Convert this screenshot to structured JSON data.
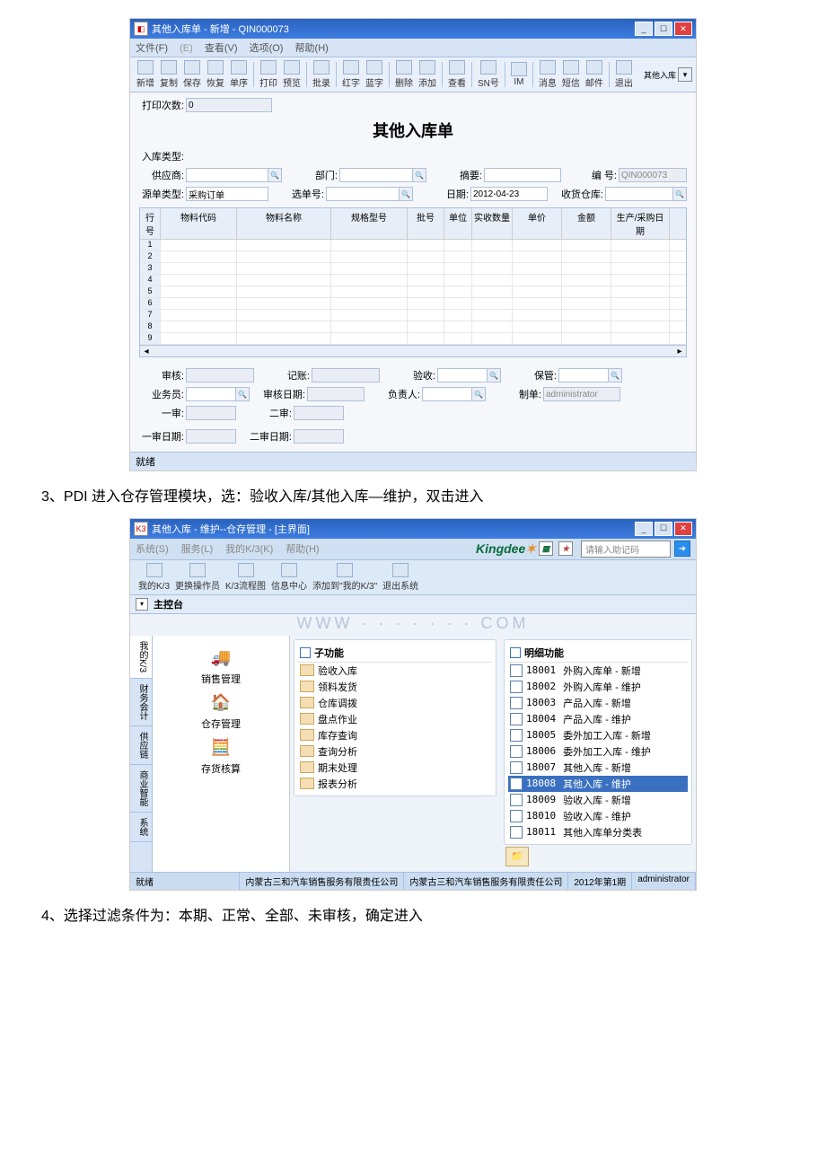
{
  "win1": {
    "title": "其他入库单 - 新增 - QIN000073",
    "menus": {
      "file": "文件(F)",
      "view": "查看(V)",
      "option": "选项(O)",
      "help": "帮助(H)"
    },
    "toolbar": [
      "新增",
      "复制",
      "保存",
      "恢复",
      "单序",
      "打印",
      "预览",
      "批录",
      "红字",
      "蓝字",
      "删除",
      "添加",
      "查看",
      "SN号",
      "IM",
      "消息",
      "短信",
      "邮件",
      "退出"
    ],
    "module": "其他入库",
    "form_title": "其他入库单",
    "fields": {
      "print_count": "打印次数:",
      "print_count_val": "0",
      "in_type": "入库类型:",
      "supplier": "供应商:",
      "dept": "部门:",
      "summary": "摘要:",
      "doc_no": "编    号:",
      "doc_no_val": "QIN000073",
      "src_type": "源单类型:",
      "src_type_val": "采购订单",
      "select_no": "选单号:",
      "date": "日期:",
      "date_val": "2012-04-23",
      "rcv_wh": "收货仓库:"
    },
    "cols": [
      "行号",
      "物料代码",
      "物料名称",
      "规格型号",
      "批号",
      "单位",
      "实收数量",
      "单价",
      "金额",
      "生产/采购日期"
    ],
    "rows": [
      "1",
      "2",
      "3",
      "4",
      "5",
      "6",
      "7",
      "8",
      "9"
    ],
    "footer": {
      "approve": "审核:",
      "post": "记账:",
      "inspect": "验收:",
      "keeper": "保管:",
      "sales": "业务员:",
      "approve_date": "审核日期:",
      "head": "负责人:",
      "maker": "制单:",
      "maker_val": "administrator",
      "first": "一审:",
      "second": "二审:",
      "first_date": "一审日期:",
      "second_date": "二审日期:"
    },
    "status": "就绪"
  },
  "para1": "3、PDI 进入仓存管理模块，选：验收入库/其他入库—维护，双击进入",
  "win2": {
    "title": "其他入库 - 维护--仓存管理 - [主界面]",
    "menus": {
      "sys": "系统(S)",
      "svc": "服务(L)",
      "myk3": "我的K/3(K)",
      "help": "帮助(H)"
    },
    "brand": "Kingdee",
    "help_ph": "请输入助记码",
    "toolbar": [
      {
        "k": "myk3",
        "l": "我的K/3"
      },
      {
        "k": "chop",
        "l": "更换操作员"
      },
      {
        "k": "flow",
        "l": "K/3流程图"
      },
      {
        "k": "info",
        "l": "信息中心"
      },
      {
        "k": "add",
        "l": "添加到\"我的K/3\""
      },
      {
        "k": "exit",
        "l": "退出系统"
      }
    ],
    "console": "主控台",
    "vtabs": [
      "我的K/3",
      "财务会计",
      "供应链",
      "商业智能",
      "系统"
    ],
    "nav": [
      {
        "icon": "🚚",
        "l": "销售管理"
      },
      {
        "icon": "🏠",
        "l": "仓存管理"
      },
      {
        "icon": "🧮",
        "l": "存货核算"
      }
    ],
    "sub_title": "子功能",
    "sub_items": [
      "验收入库",
      "领料发货",
      "仓库调拨",
      "盘点作业",
      "库存查询",
      "查询分析",
      "期末处理",
      "报表分析"
    ],
    "detail_title": "明细功能",
    "detail_items": [
      {
        "c": "18001",
        "l": "外购入库单 - 新增"
      },
      {
        "c": "18002",
        "l": "外购入库单 - 维护"
      },
      {
        "c": "18003",
        "l": "产品入库 - 新增"
      },
      {
        "c": "18004",
        "l": "产品入库 - 维护"
      },
      {
        "c": "18005",
        "l": "委外加工入库 - 新增"
      },
      {
        "c": "18006",
        "l": "委外加工入库 - 维护"
      },
      {
        "c": "18007",
        "l": "其他入库 - 新增"
      },
      {
        "c": "18008",
        "l": "其他入库 - 维护",
        "sel": true
      },
      {
        "c": "18009",
        "l": "验收入库 - 新增"
      },
      {
        "c": "18010",
        "l": "验收入库 - 维护"
      },
      {
        "c": "18011",
        "l": "其他入库单分类表"
      }
    ],
    "status": {
      "ready": "就绪",
      "co1": "内蒙古三和汽车销售服务有限责任公司",
      "co2": "内蒙古三和汽车销售服务有限责任公司",
      "period": "2012年第1期",
      "user": "administrator"
    }
  },
  "para2": "4、选择过滤条件为：本期、正常、全部、未审核，确定进入"
}
